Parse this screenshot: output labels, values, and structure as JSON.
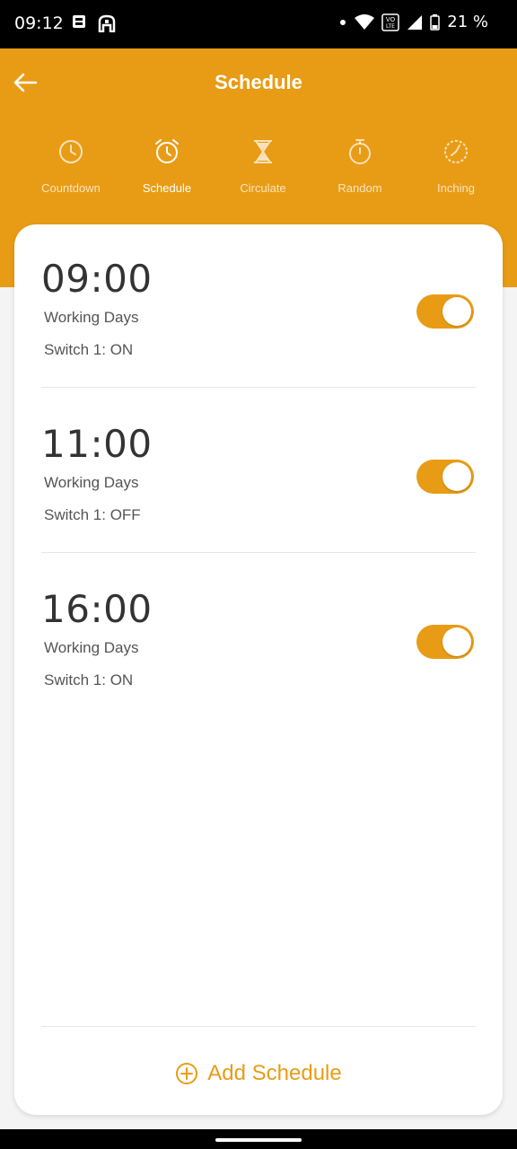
{
  "status_bar": {
    "time": "09:12",
    "battery": "21 %",
    "icons": [
      "sim-card-icon",
      "notification-icon",
      "dot-icon",
      "wifi-icon",
      "volte-icon",
      "signal-icon",
      "battery-icon"
    ]
  },
  "header": {
    "title": "Schedule",
    "back_icon": "back-arrow-icon"
  },
  "tabs": [
    {
      "label": "Countdown",
      "icon": "clock-icon",
      "active": false
    },
    {
      "label": "Schedule",
      "icon": "alarm-clock-icon",
      "active": true
    },
    {
      "label": "Circulate",
      "icon": "hourglass-icon",
      "active": false
    },
    {
      "label": "Random",
      "icon": "stopwatch-icon",
      "active": false
    },
    {
      "label": "Inching",
      "icon": "timer-icon",
      "active": false
    }
  ],
  "schedules": [
    {
      "time": "09:00",
      "days": "Working Days",
      "action": "Switch 1: ON",
      "enabled": true
    },
    {
      "time": "11:00",
      "days": "Working Days",
      "action": "Switch 1: OFF",
      "enabled": true
    },
    {
      "time": "16:00",
      "days": "Working Days",
      "action": "Switch 1: ON",
      "enabled": true
    }
  ],
  "add_button": {
    "label": "Add Schedule",
    "icon": "plus-circle-icon"
  },
  "colors": {
    "accent": "#e89c15",
    "card": "#ffffff",
    "background": "#f4f4f4"
  }
}
